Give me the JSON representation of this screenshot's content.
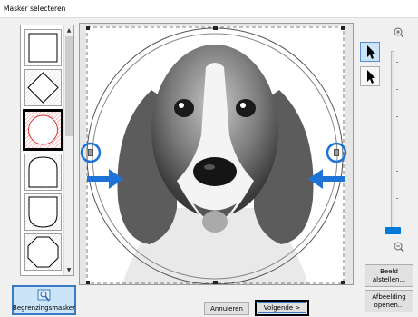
{
  "window": {
    "title": "Masker selecteren"
  },
  "mask_list": {
    "items": [
      {
        "shape": "square",
        "selected": false
      },
      {
        "shape": "diamond",
        "selected": false
      },
      {
        "shape": "circle",
        "selected": true
      },
      {
        "shape": "arch",
        "selected": false
      },
      {
        "shape": "shield",
        "selected": false
      },
      {
        "shape": "octagon",
        "selected": false
      }
    ],
    "scroll_up_icon": "triangle-up-icon",
    "scroll_down_icon": "triangle-down-icon"
  },
  "tools": {
    "select_tool": "arrow-pointer-icon",
    "move_tool": "arrow-pointer-icon",
    "zoom_in_icon": "magnifier-plus-icon",
    "zoom_out_icon": "magnifier-minus-icon",
    "zoom_level_fraction": 0.0
  },
  "buttons": {
    "fit_image": "Beeld\nalstellen...",
    "open_image": "Afbeelding\nopenen...",
    "mask_boundary": "Begrenzingsmasker",
    "cancel": "Annuleren",
    "next": "Volgende >"
  },
  "colors": {
    "accent": "#1e73d8",
    "selected_mask_fill": "#f25a5a",
    "highlight_border": "#000000"
  }
}
